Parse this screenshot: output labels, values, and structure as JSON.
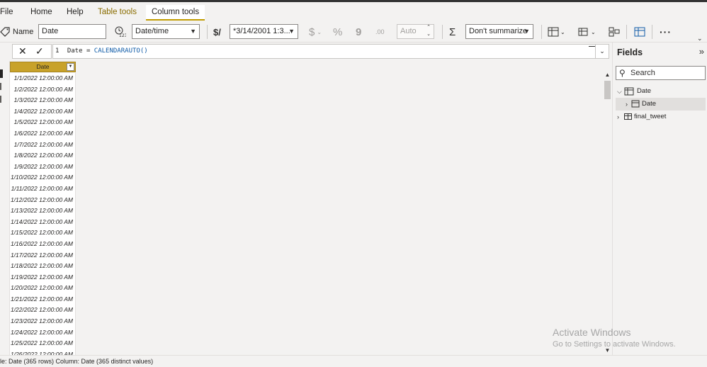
{
  "menu": {
    "tabs": [
      {
        "label": "File"
      },
      {
        "label": "Home"
      },
      {
        "label": "Help"
      },
      {
        "label": "Table tools"
      },
      {
        "label": "Column tools"
      }
    ]
  },
  "ribbon": {
    "name_label": "Name",
    "name_value": "Date",
    "data_type": "Date/time",
    "format_value": "*3/14/2001 1:3...",
    "decimals_value": "Auto",
    "summarize_value": "Don't summarize",
    "currency_symbol": "$",
    "percent_symbol": "%",
    "comma_symbol": "9",
    "decimal_symbol": ".00",
    "sigma_symbol": "Σ",
    "more_symbol": "···"
  },
  "formula": {
    "line_no": "1",
    "text_column": "Date",
    "text_eq": "=",
    "text_func": "CALENDARAUTO()"
  },
  "grid": {
    "column_header": "Date",
    "rows": [
      "1/1/2022 12:00:00 AM",
      "1/2/2022 12:00:00 AM",
      "1/3/2022 12:00:00 AM",
      "1/4/2022 12:00:00 AM",
      "1/5/2022 12:00:00 AM",
      "1/6/2022 12:00:00 AM",
      "1/7/2022 12:00:00 AM",
      "1/8/2022 12:00:00 AM",
      "1/9/2022 12:00:00 AM",
      "1/10/2022 12:00:00 AM",
      "1/11/2022 12:00:00 AM",
      "1/12/2022 12:00:00 AM",
      "1/13/2022 12:00:00 AM",
      "1/14/2022 12:00:00 AM",
      "1/15/2022 12:00:00 AM",
      "1/16/2022 12:00:00 AM",
      "1/17/2022 12:00:00 AM",
      "1/18/2022 12:00:00 AM",
      "1/19/2022 12:00:00 AM",
      "1/20/2022 12:00:00 AM",
      "1/21/2022 12:00:00 AM",
      "1/22/2022 12:00:00 AM",
      "1/23/2022 12:00:00 AM",
      "1/24/2022 12:00:00 AM",
      "1/25/2022 12:00:00 AM",
      "1/26/2022 12:00:00 AM"
    ]
  },
  "fields": {
    "title": "Fields",
    "search_placeholder": "Search",
    "items": [
      {
        "label": "Date",
        "expanded": true
      },
      {
        "label": "Date",
        "selected": true
      },
      {
        "label": "final_tweet",
        "expanded": false
      }
    ]
  },
  "status": {
    "text": "le: Date (365 rows) Column: Date (365 distinct values)"
  },
  "watermark": {
    "title": "Activate Windows",
    "subtitle": "Go to Settings to activate Windows."
  },
  "colors": {
    "accent": "#c19c00",
    "header_fill": "#c8a22a",
    "background": "#f3f2f1"
  }
}
